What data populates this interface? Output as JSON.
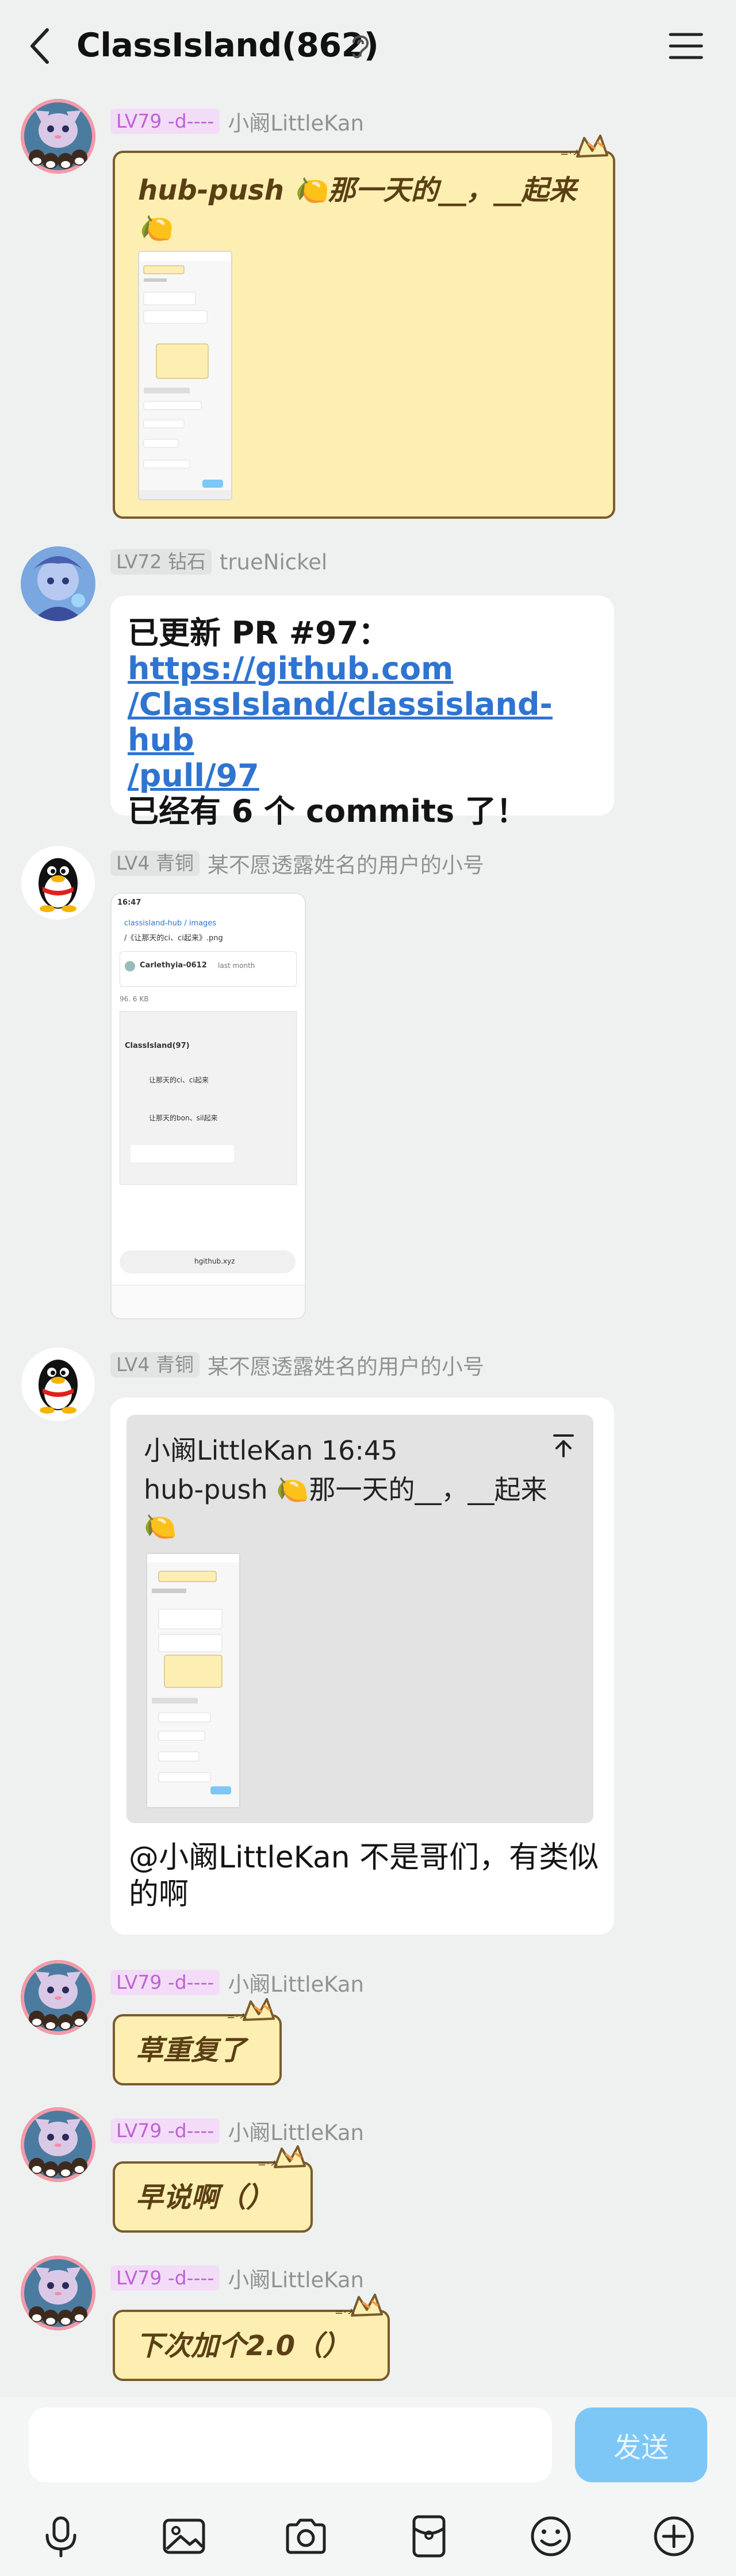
{
  "header": {
    "title": "ClassIsland(862)"
  },
  "messages": [
    {
      "level": "LV79 -d----",
      "name": "小阚LittleKan",
      "text": "hub-push 🍋那一天的__，__起来🍋"
    },
    {
      "level": "LV72 钻石",
      "name": "trueNickel",
      "line1": "已更新 PR #97：",
      "link": "https://github.com/ClassIsland/classisland-hub/pull/97",
      "link_parts": [
        "https://github.com",
        "/ClassIsland/classisland-hub",
        "/pull/97"
      ],
      "line3": "已经有 6 个 commits 了！"
    },
    {
      "level": "LV4 青铜",
      "name": "某不愿透露姓名的用户的小号",
      "screenshot": {
        "time": "16:47",
        "repo": "classisland-hub / images",
        "path": "/《让那天的ci、ci起来》.png",
        "author": "Carlethyia-0612",
        "when": "last month",
        "size": "96. 6 KB",
        "chat_title": "ClassIsland(97)",
        "msg1": "让那天的ci、ci起来",
        "msg2": "让那天的bon、sil起来",
        "url": "hgithub.xyz"
      }
    },
    {
      "level": "LV4 青铜",
      "name": "某不愿透露姓名的用户的小号",
      "reply_meta": "小阚LittleKan 16:45",
      "reply_text": "hub-push 🍋那一天的__，__起来🍋",
      "text": "@小阚LittleKan 不是哥们，有类似的啊"
    },
    {
      "level": "LV79 -d----",
      "name": "小阚LittleKan",
      "text": "草重复了"
    },
    {
      "level": "LV79 -d----",
      "name": "小阚LittleKan",
      "text": "早说啊（）"
    },
    {
      "level": "LV79 -d----",
      "name": "小阚LittleKan",
      "text": "下次加个2.0（）"
    }
  ],
  "input": {
    "send_label": "发送"
  },
  "colors": {
    "background": "#eff1f0",
    "cat_bubble": "#fdefb2",
    "link": "#2f74d0",
    "send": "#7dc7f6"
  }
}
